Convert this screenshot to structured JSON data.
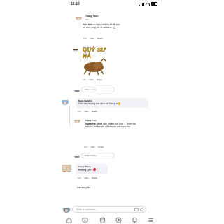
{
  "status_bar": {
    "time": "12:16"
  },
  "comments": [
    {
      "author": "Trang Tron",
      "meta": "10h",
      "author_inline": "Vân Anh",
      "text": "tó bgio chăm chỉ để sau có con rụng tóc là vừa c.a :(((",
      "actions": [
        "14h",
        "Like",
        "Reply"
      ]
    },
    {
      "author": "Vân Anh",
      "sticker_text": "QUỲ SƯ HÀ",
      "actions": [
        "14h",
        "Like",
        "Reply"
      ]
    },
    {
      "author": "Ngân Hà Minh",
      "text": "Dạo này k rụng tóc nữa rồi Trang à",
      "actions": [
        "14h",
        "Like",
        "Reply"
      ]
    },
    {
      "author": "Trang Tron",
      "author_inline": "Ngân Hà Minh",
      "text": "uầy, chăm chỉ thía :) Trộm vía bạn tui, chăm chỉ xịt nha nó còn mọc tóc",
      "actions": [
        "14h",
        "Like",
        "Reply"
      ]
    },
    {
      "author": "Giang Phùng",
      "author_inline": "Hoàng Lan",
      "actions": [
        "14h",
        "Like",
        "Reply"
      ]
    },
    {
      "author": "Trần Đông Thị"
    }
  ],
  "reply_placeholder": "Write a reply...",
  "composer_placeholder": "Write a comment...",
  "tabs": [
    "home-icon",
    "video-icon",
    "marketplace-icon",
    "groups-icon",
    "notifications-icon",
    "menu-icon"
  ],
  "colors": {
    "accent": "#1877f2",
    "bubble": "#f0f2f5",
    "text": "#1c1e21",
    "muted": "#65676b"
  }
}
